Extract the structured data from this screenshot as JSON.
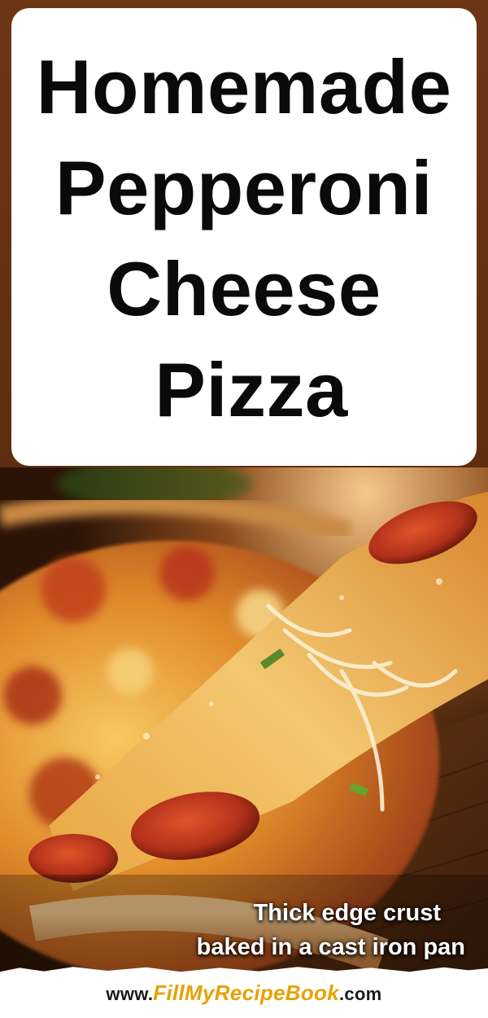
{
  "title": {
    "line1": "Homemade",
    "line2": "Pepperoni",
    "line3": "Cheese",
    "line4": "Pizza"
  },
  "photo": {
    "subject": "pizza-slice-with-cheese-pull"
  },
  "caption": {
    "line1": "Thick edge crust",
    "line2": "baked in a cast iron pan"
  },
  "footer": {
    "prefix": "www.",
    "brand": "FillMyRecipeBook",
    "suffix": ".com"
  },
  "colors": {
    "frame_brown": "#6a3416",
    "title_text": "#0a0a0a",
    "card_bg": "#ffffff",
    "brand_yellow": "#e6a200"
  }
}
